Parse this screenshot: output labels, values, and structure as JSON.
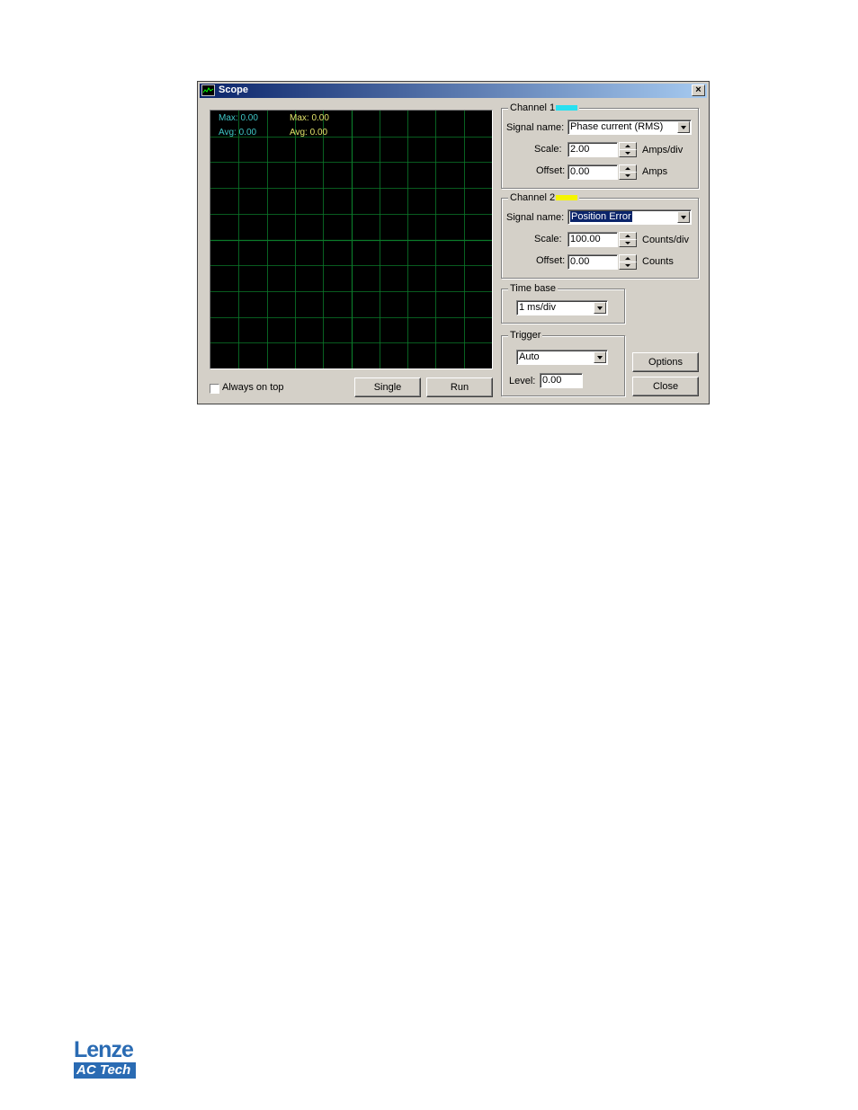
{
  "window": {
    "title": "Scope",
    "close_glyph": "×"
  },
  "scope": {
    "ch1_max_label": "Max:",
    "ch1_max_value": "0.00",
    "ch1_avg_label": "Avg:",
    "ch1_avg_value": "0.00",
    "ch2_max_label": "Max:",
    "ch2_max_value": "0.00",
    "ch2_avg_label": "Avg:",
    "ch2_avg_value": "0.00",
    "grid_color": "#0b7a2a",
    "ch1_color": "#3fc6c6",
    "ch2_color": "#e3e36a"
  },
  "controls": {
    "always_on_top_label": "Always on top",
    "always_on_top_checked": false,
    "single_label": "Single",
    "run_label": "Run",
    "options_label": "Options",
    "close_label": "Close"
  },
  "channel1": {
    "title": "Channel 1",
    "swatch_color": "#29e0f0",
    "signal_label": "Signal name:",
    "signal_value": "Phase current (RMS)",
    "scale_label": "Scale:",
    "scale_value": "2.00",
    "scale_unit": "Amps/div",
    "offset_label": "Offset:",
    "offset_value": "0.00",
    "offset_unit": "Amps"
  },
  "channel2": {
    "title": "Channel 2",
    "swatch_color": "#f5f500",
    "signal_label": "Signal name:",
    "signal_value": "Position Error",
    "scale_label": "Scale:",
    "scale_value": "100.00",
    "scale_unit": "Counts/div",
    "offset_label": "Offset:",
    "offset_value": "0.00",
    "offset_unit": "Counts"
  },
  "timebase": {
    "title": "Time base",
    "value": "1 ms/div"
  },
  "trigger": {
    "title": "Trigger",
    "mode_value": "Auto",
    "level_label": "Level:",
    "level_value": "0.00"
  },
  "logo": {
    "brand_top": "Lenze",
    "brand_bottom": "AC Tech"
  },
  "icons": [
    "scope-app-icon",
    "close-icon",
    "dropdown-arrow-icon",
    "spin-up-icon",
    "spin-down-icon",
    "checkbox-icon"
  ]
}
